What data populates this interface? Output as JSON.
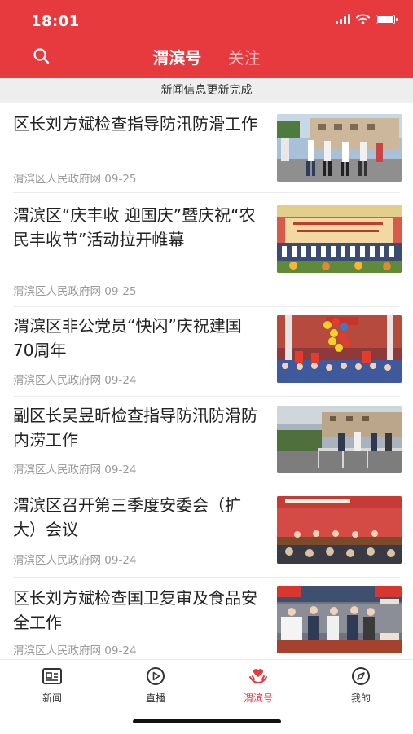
{
  "status_bar": {
    "time": "18:01"
  },
  "header": {
    "tabs": [
      {
        "label": "渭滨号",
        "active": true
      },
      {
        "label": "关注",
        "active": false
      }
    ],
    "accent_color": "#e63a3e"
  },
  "notice": {
    "text": "新闻信息更新完成"
  },
  "news": [
    {
      "title": "区长刘方斌检查指导防汛防滑工作",
      "source": "渭滨区人民政府网",
      "date": "09-25",
      "thumb": "inspection-outdoor-photo"
    },
    {
      "title": "渭滨区“庆丰收 迎国庆”暨庆祝“农民丰收节”活动拉开帷幕",
      "source": "渭滨区人民政府网",
      "date": "09-25",
      "thumb": "harvest-festival-stage-photo"
    },
    {
      "title": "渭滨区非公党员“快闪”庆祝建国70周年",
      "source": "渭滨区人民政府网",
      "date": "09-24",
      "thumb": "flash-mob-balloons-photo"
    },
    {
      "title": "副区长吴昱昕检查指导防汛防滑防内涝工作",
      "source": "渭滨区人民政府网",
      "date": "09-24",
      "thumb": "riverside-inspection-photo"
    },
    {
      "title": "渭滨区召开第三季度安委会（扩大）会议",
      "source": "渭滨区人民政府网",
      "date": "09-24",
      "thumb": "meeting-room-photo"
    },
    {
      "title": "区长刘方斌检查国卫复审及食品安全工作",
      "source": "渭滨区人民政府网",
      "date": "09-24",
      "thumb": "market-inspection-photo"
    }
  ],
  "tabbar": [
    {
      "label": "新闻",
      "icon": "newspaper-icon",
      "active": false
    },
    {
      "label": "直播",
      "icon": "play-circle-icon",
      "active": false
    },
    {
      "label": "渭滨号",
      "icon": "heart-hands-icon",
      "active": true
    },
    {
      "label": "我的",
      "icon": "compass-icon",
      "active": false
    }
  ]
}
